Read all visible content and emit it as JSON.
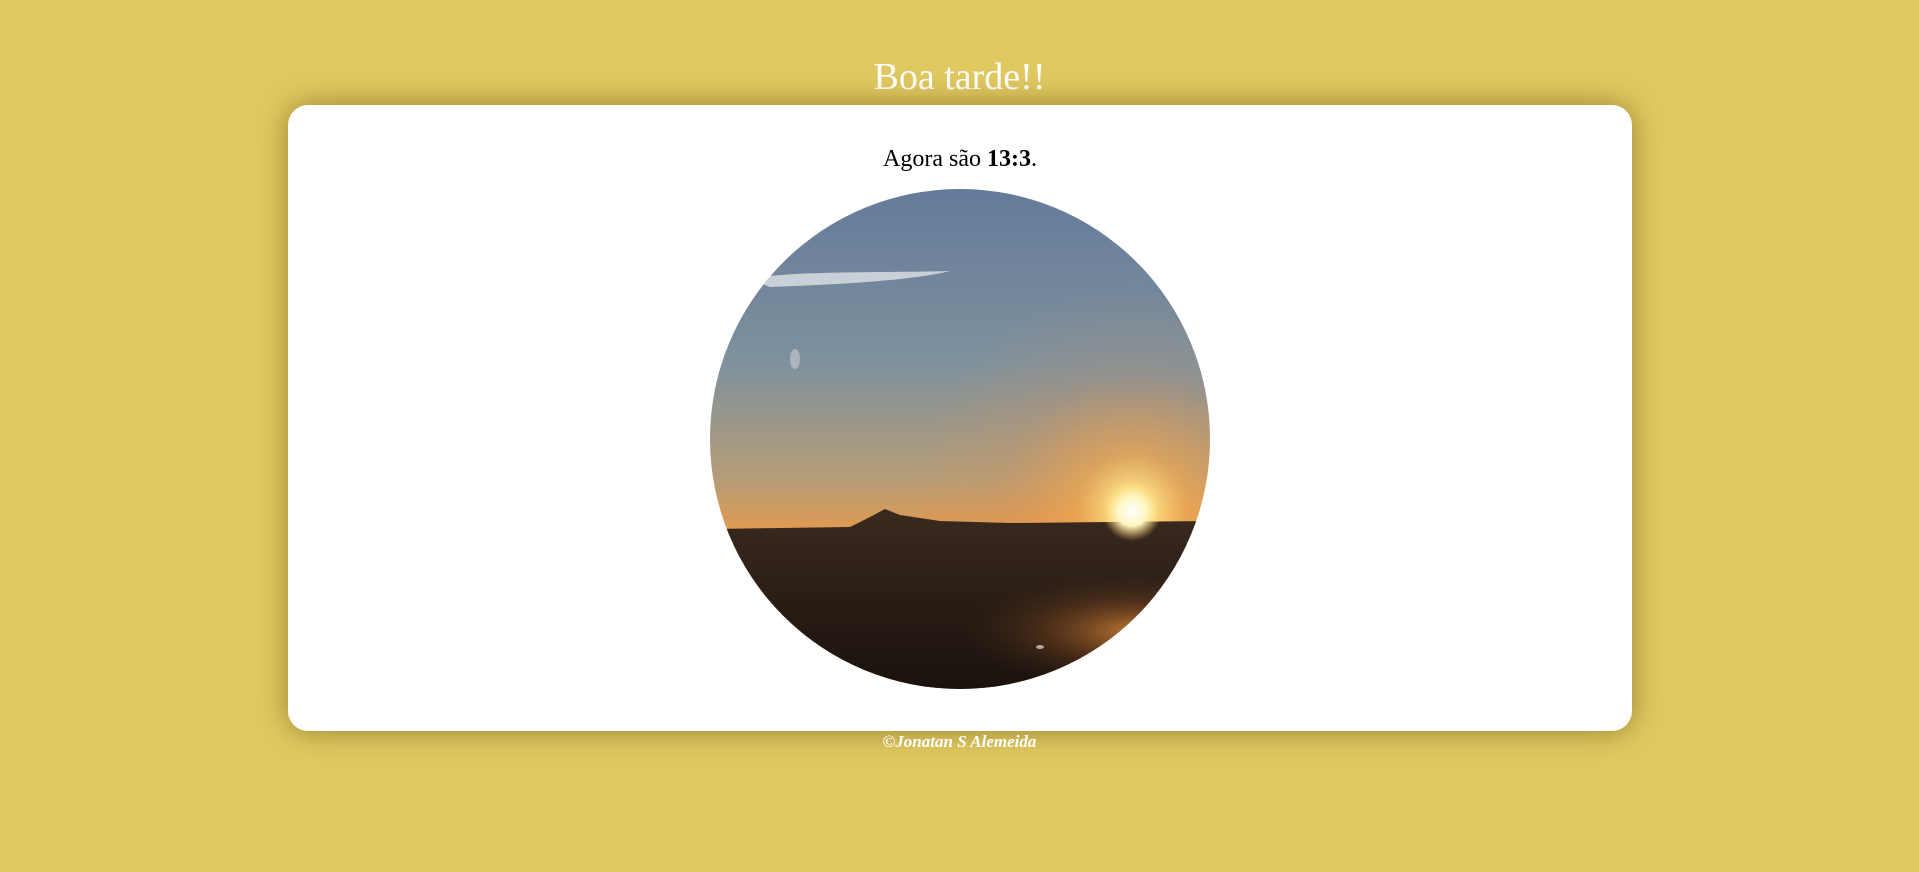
{
  "greeting": "Boa tarde!!",
  "time_message": {
    "prefix": "Agora são ",
    "time": "13:3",
    "suffix": "."
  },
  "photo": {
    "subject": "sunset over a mountain horizon"
  },
  "footer": {
    "credit": "©Jonatan S Alemeida"
  },
  "colors": {
    "background": "#e1c961",
    "card": "#ffffff",
    "heading_text": "#ffffff"
  }
}
